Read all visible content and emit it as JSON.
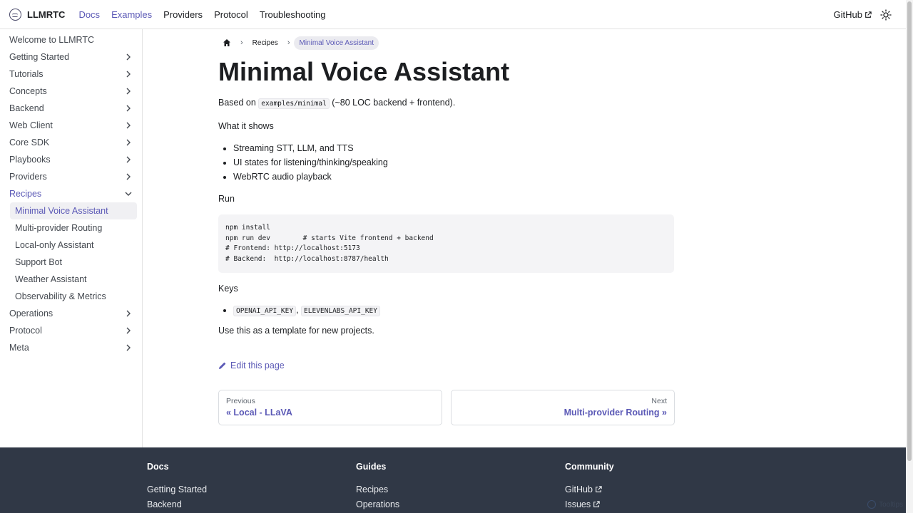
{
  "navbar": {
    "brand": "LLMRTC",
    "links": [
      {
        "label": "Docs",
        "active": true
      },
      {
        "label": "Examples",
        "active": true
      },
      {
        "label": "Providers",
        "active": false
      },
      {
        "label": "Protocol",
        "active": false
      },
      {
        "label": "Troubleshooting",
        "active": false
      }
    ],
    "github": "GitHub",
    "theme_toggle_icon": "sun-icon"
  },
  "sidebar": {
    "top_item": "Welcome to LLMRTC",
    "items": [
      "Getting Started",
      "Tutorials",
      "Concepts",
      "Backend",
      "Web Client",
      "Core SDK",
      "Playbooks",
      "Providers"
    ],
    "expanded": {
      "label": "Recipes",
      "children": [
        "Minimal Voice Assistant",
        "Multi-provider Routing",
        "Local-only Assistant",
        "Support Bot",
        "Weather Assistant",
        "Observability & Metrics"
      ],
      "active_child": "Minimal Voice Assistant"
    },
    "items_after": [
      "Operations",
      "Protocol",
      "Meta"
    ]
  },
  "breadcrumb": {
    "home_icon": "home-icon",
    "section": "Recipes",
    "current": "Minimal Voice Assistant"
  },
  "content": {
    "title": "Minimal Voice Assistant",
    "intro_prefix": "Based on ",
    "intro_code": "examples/minimal",
    "intro_suffix": " (~80 LOC backend + frontend).",
    "shows_heading": "What it shows",
    "shows": [
      "Streaming STT, LLM, and TTS",
      "UI states for listening/thinking/speaking",
      "WebRTC audio playback"
    ],
    "run_heading": "Run",
    "code_lines": [
      "npm install",
      "npm run dev        # starts Vite frontend + backend",
      "# Frontend: http://localhost:5173",
      "# Backend:  http://localhost:8787/health"
    ],
    "keys_heading": "Keys",
    "key_1": "OPENAI_API_KEY",
    "key_sep": ", ",
    "key_2": "ELEVENLABS_API_KEY",
    "outro": "Use this as a template for new projects.",
    "edit_link": "Edit this page"
  },
  "pager": {
    "prev_sub": "Previous",
    "prev_label": "« Local - LLaVA",
    "next_sub": "Next",
    "next_label": "Multi-provider Routing »"
  },
  "footer": {
    "columns": [
      {
        "title": "Docs",
        "links": [
          "Getting Started",
          "Backend"
        ]
      },
      {
        "title": "Guides",
        "links": [
          "Recipes",
          "Operations"
        ]
      },
      {
        "title": "Community",
        "links": [
          "GitHub",
          "Issues"
        ]
      }
    ],
    "badge": "Tooltips"
  }
}
